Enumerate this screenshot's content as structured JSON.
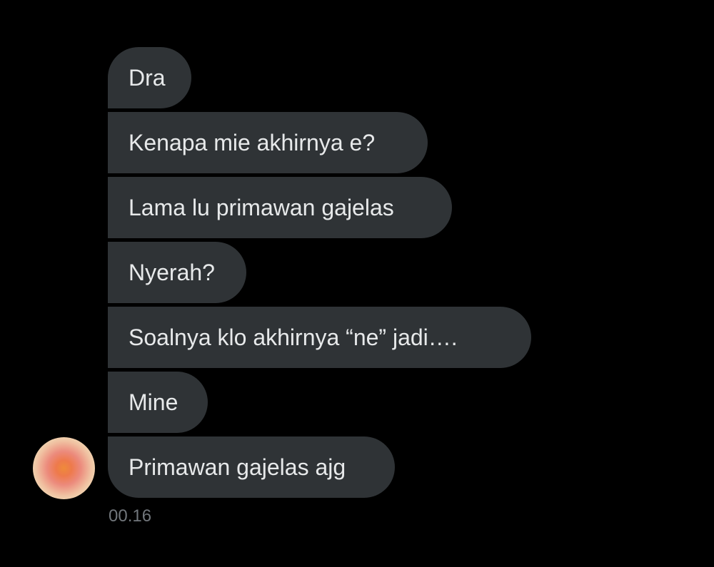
{
  "conversation": {
    "messages": [
      {
        "text": "Dra"
      },
      {
        "text": "Kenapa mie akhirnya e?"
      },
      {
        "text": "Lama lu primawan gajelas"
      },
      {
        "text": "Nyerah?"
      },
      {
        "text": "Soalnya klo akhirnya “ne” jadi…."
      },
      {
        "text": "Mine"
      },
      {
        "text": "Primawan gajelas ajg"
      }
    ],
    "timestamp": "00.16"
  },
  "colors": {
    "background": "#000000",
    "bubble": "#2f3336",
    "bubble_text": "#e7e9ea",
    "timestamp_text": "#71767b"
  }
}
